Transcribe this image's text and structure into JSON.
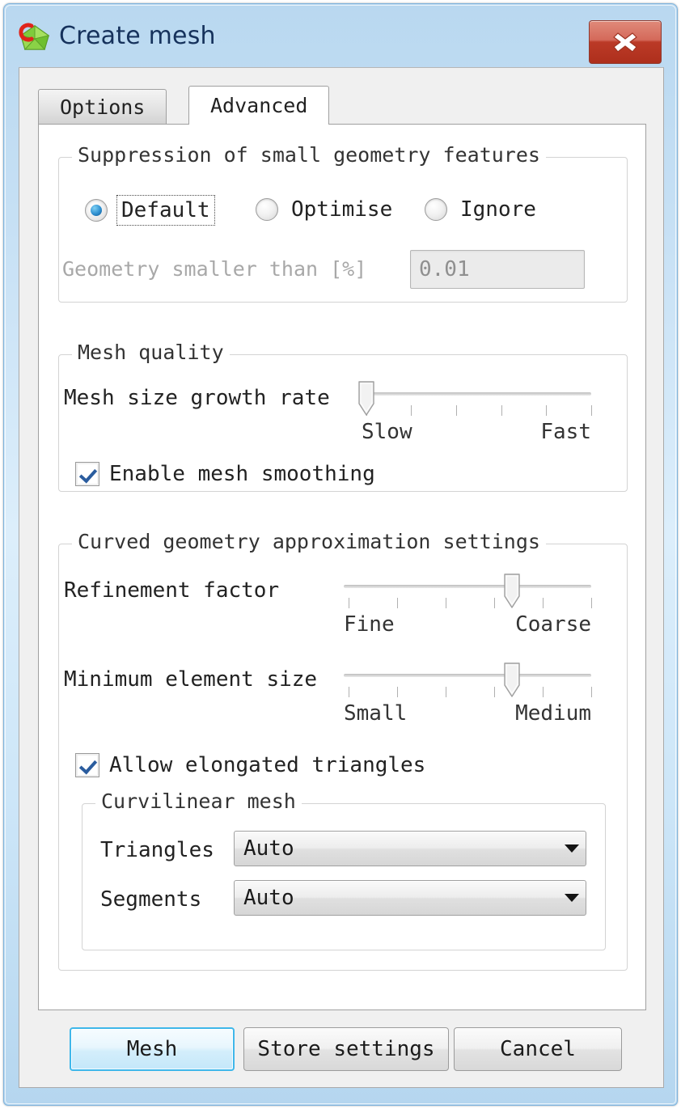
{
  "window": {
    "title": "Create mesh",
    "app_icon": "mesh-gem-icon",
    "close_label": "close-icon",
    "accent": "#3fb7ea",
    "close_color": "#bb3a27"
  },
  "tabs": [
    {
      "label": "Options",
      "active": false
    },
    {
      "label": "Advanced",
      "active": true
    }
  ],
  "suppression": {
    "title": "Suppression of small geometry features",
    "options": [
      {
        "label": "Default",
        "selected": true,
        "focused": true
      },
      {
        "label": "Optimise",
        "selected": false,
        "focused": false
      },
      {
        "label": "Ignore",
        "selected": false,
        "focused": false
      }
    ],
    "threshold_label": "Geometry smaller than [%]",
    "threshold_value": "0.01",
    "threshold_enabled": false
  },
  "mesh_quality": {
    "title": "Mesh quality",
    "growth_rate": {
      "label": "Mesh size growth rate",
      "min_label": "Slow",
      "max_label": "Fast",
      "position_pct": 2,
      "ticks": 6
    },
    "smoothing": {
      "label": "Enable mesh smoothing",
      "checked": true
    }
  },
  "curved_geometry": {
    "title": "Curved geometry approximation settings",
    "refinement": {
      "label": "Refinement factor",
      "min_label": "Fine",
      "max_label": "Coarse",
      "position_pct": 68,
      "ticks": 6
    },
    "min_element": {
      "label": "Minimum element size",
      "min_label": "Small",
      "max_label": "Medium",
      "position_pct": 68,
      "ticks": 6
    },
    "elongated": {
      "label": "Allow elongated triangles",
      "checked": true
    },
    "curvilinear": {
      "title": "Curvilinear mesh",
      "rows": [
        {
          "label": "Triangles",
          "value": "Auto"
        },
        {
          "label": "Segments",
          "value": "Auto"
        }
      ]
    }
  },
  "footer": {
    "mesh_label": "Mesh",
    "store_label": "Store settings",
    "cancel_label": "Cancel"
  }
}
